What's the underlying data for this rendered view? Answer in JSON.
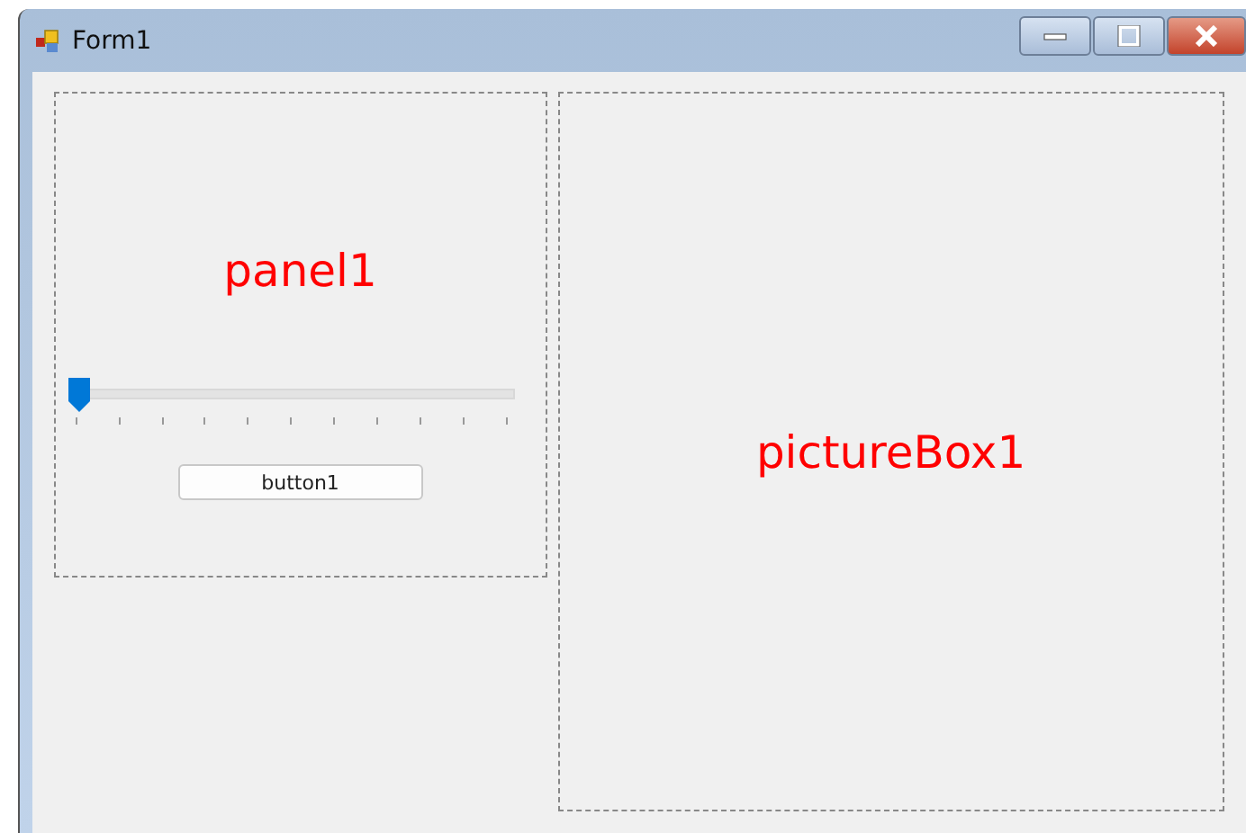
{
  "window": {
    "title": "Form1"
  },
  "panel": {
    "label": "panel1",
    "slider": {
      "level": 0
    },
    "button": "button1"
  },
  "picture_box": {
    "label": "pictureBox1"
  }
}
